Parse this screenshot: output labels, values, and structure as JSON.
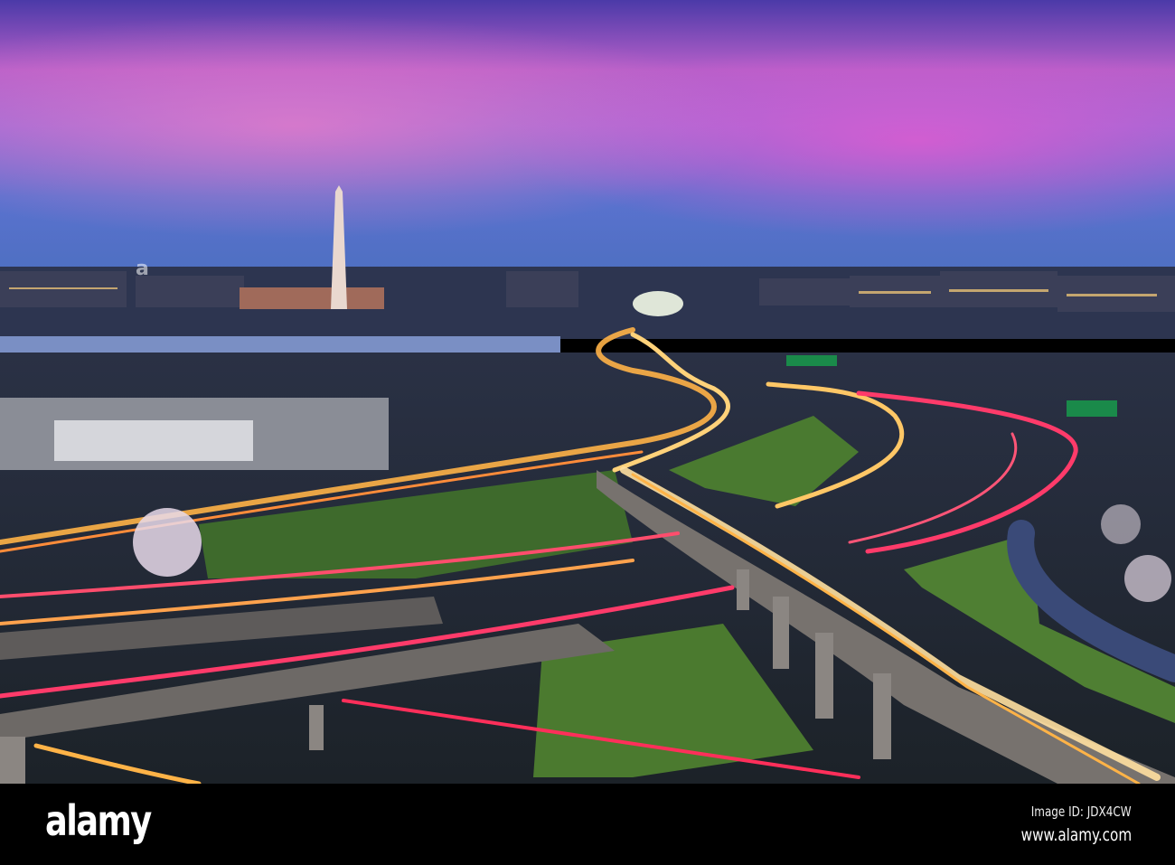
{
  "photo": {
    "colors": {
      "sky_top": "#5a3fb8",
      "sky_pink": "#d86bd0",
      "sky_horizon": "#4f74c9",
      "trail_orange": "#ffb347",
      "trail_red": "#ff3b6a",
      "grass": "#4f7a35",
      "concrete": "#6f6c6a"
    }
  },
  "footer": {
    "logo": "alamy",
    "image_id": "Image ID: JDX4CW",
    "website": "www.alamy.com"
  }
}
